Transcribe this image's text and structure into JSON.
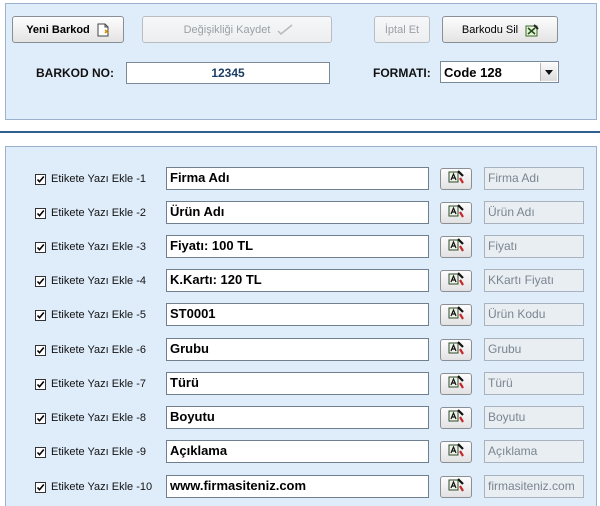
{
  "toolbar": {
    "new_barcode_label": "Yeni Barkod",
    "save_changes_label": "Değişikliği Kaydet",
    "cancel_label": "İptal Et",
    "delete_barcode_label": "Barkodu Sil"
  },
  "barcode": {
    "no_label": "BARKOD NO:",
    "no_value": "12345",
    "format_label": "FORMATI:",
    "format_value": "Code 128"
  },
  "rows": [
    {
      "label": "Etikete Yazı Ekle -1",
      "checked": true,
      "value": "Firma Adı",
      "field": "Firma Adı"
    },
    {
      "label": "Etikete Yazı Ekle -2",
      "checked": true,
      "value": "Ürün Adı",
      "field": "Ürün Adı"
    },
    {
      "label": "Etikete Yazı Ekle -3",
      "checked": true,
      "value": "Fiyatı: 100 TL",
      "field": "Fiyatı"
    },
    {
      "label": "Etikete Yazı Ekle -4",
      "checked": true,
      "value": "K.Kartı: 120 TL",
      "field": "KKartı Fiyatı"
    },
    {
      "label": "Etikete Yazı Ekle -5",
      "checked": true,
      "value": "ST0001",
      "field": "Ürün Kodu"
    },
    {
      "label": "Etikete Yazı Ekle -6",
      "checked": true,
      "value": "Grubu",
      "field": "Grubu"
    },
    {
      "label": "Etikete Yazı Ekle -7",
      "checked": true,
      "value": "Türü",
      "field": "Türü"
    },
    {
      "label": "Etikete Yazı Ekle -8",
      "checked": true,
      "value": "Boyutu",
      "field": "Boyutu"
    },
    {
      "label": "Etikete Yazı Ekle -9",
      "checked": true,
      "value": "Açıklama",
      "field": "Açıklama"
    },
    {
      "label": "Etikete Yazı Ekle -10",
      "checked": true,
      "value": "www.firmasiteniz.com",
      "field": "firmasiteniz.com"
    }
  ],
  "icons": {
    "new_barcode": "new-document-icon",
    "save_changes": "checkmark-icon",
    "delete_barcode": "delete-icon",
    "font_picker": "font-icon",
    "dropdown": "chevron-down-icon"
  }
}
